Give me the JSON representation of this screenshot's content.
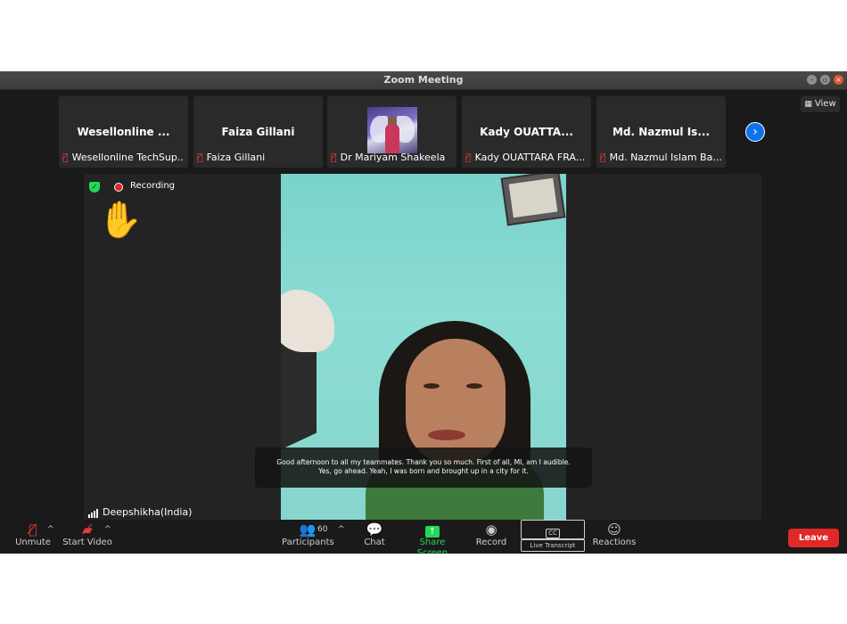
{
  "window": {
    "title": "Zoom Meeting"
  },
  "view_button": {
    "label": "View",
    "icon": "grid-icon"
  },
  "tiles": [
    {
      "display_name": "Wesellonline ...",
      "label": "Wesellonline TechSup..."
    },
    {
      "display_name": "Faiza Gillani",
      "label": "Faiza Gillani"
    },
    {
      "display_name": "",
      "label": "Dr Mariyam Shakeela"
    },
    {
      "display_name": "Kady OUATTA...",
      "label": "Kady OUATTARA FRA..."
    },
    {
      "display_name": "Md. Nazmul Is...",
      "label": "Md. Nazmul Islam Ba..."
    }
  ],
  "stage": {
    "recording_label": "Recording",
    "speaker_name": "Deepshikha(India)",
    "caption_lines": [
      "Good afternoon to all my teammates. Thank you so much. First of all, MI, am I audible.",
      "Yes, go ahead. Yeah, I was born and brought up in a city for it."
    ]
  },
  "toolbar": {
    "unmute": "Unmute",
    "start_video": "Start Video",
    "participants": "Participants",
    "participants_count": "60",
    "chat": "Chat",
    "share_screen": "Share Screen",
    "record": "Record",
    "live_transcript": "Live Transcript",
    "live_transcript_icon_text": "CC",
    "reactions": "Reactions",
    "leave": "Leave"
  },
  "colors": {
    "accent_blue": "#0e72ed",
    "share_green": "#23d959",
    "leave_red": "#e02828",
    "mic_off_red": "#e23b3b"
  }
}
